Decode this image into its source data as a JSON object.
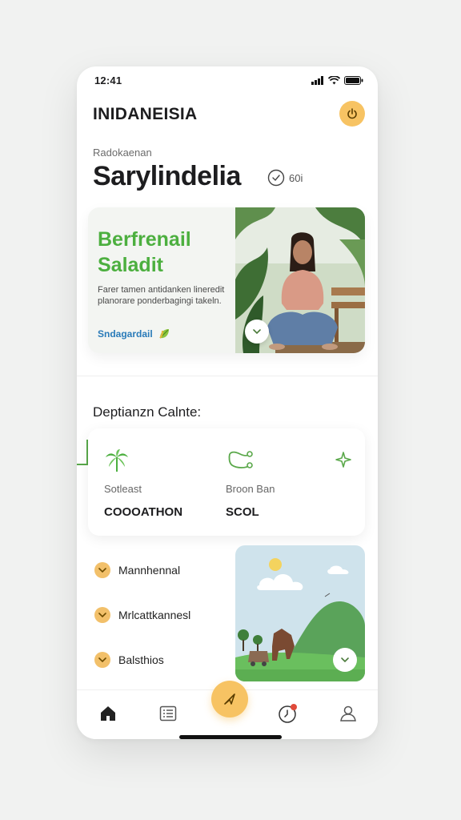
{
  "status_bar": {
    "time": "12:41"
  },
  "header": {
    "app_title": "INIDANEISIA"
  },
  "hero": {
    "subtitle": "Radokaenan",
    "title": "Sarylindelia",
    "meta": "60i"
  },
  "featured": {
    "title_line1": "Berfrenail",
    "title_line2": "Saladit",
    "description": "Farer tamen antidanken lineredit planorare ponderbagingi takeln.",
    "link_label": "Sndagardail"
  },
  "section": {
    "title": "Deptianzn Calnte:"
  },
  "stats": [
    {
      "icon": "palm-tree-icon",
      "label": "Sotleast",
      "value": "COOOATHON"
    },
    {
      "icon": "route-icon",
      "label": "Broon  Ban",
      "value": "SCOL"
    },
    {
      "icon": "sparkle-icon",
      "label": "",
      "value": ""
    }
  ],
  "list": [
    {
      "label": "Mannhennal"
    },
    {
      "label": "Mrlcattkannesl"
    },
    {
      "label": "Balsthios"
    }
  ],
  "tabs": [
    {
      "name": "home",
      "icon": "home-icon"
    },
    {
      "name": "list",
      "icon": "list-icon"
    },
    {
      "name": "compose",
      "icon": "send-icon"
    },
    {
      "name": "activity",
      "icon": "clock-icon"
    },
    {
      "name": "profile",
      "icon": "user-icon"
    }
  ],
  "colors": {
    "accent": "#f7c363",
    "green": "#4caf3f",
    "link": "#2a7bb9"
  }
}
